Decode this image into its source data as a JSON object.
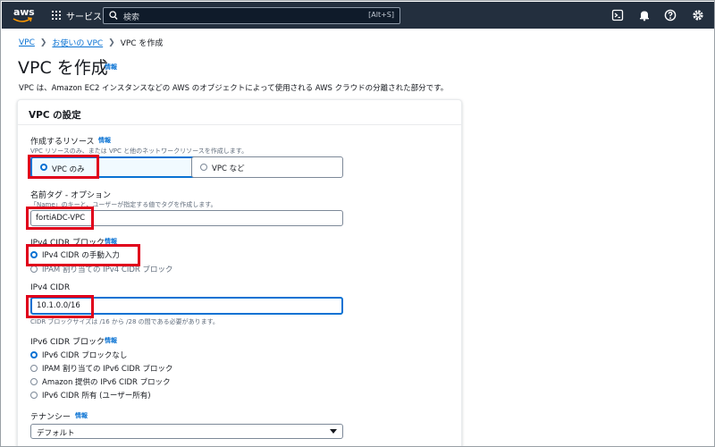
{
  "nav": {
    "logo_text": "aws",
    "services_label": "サービス",
    "search_placeholder": "検索",
    "search_shortcut": "[Alt+S]"
  },
  "breadcrumb": {
    "items": [
      "VPC",
      "お使いの VPC",
      "VPC を作成"
    ]
  },
  "page": {
    "title": "VPC を作成",
    "info": "情報",
    "description": "VPC は、Amazon EC2 インスタンスなどの AWS のオブジェクトによって使用される AWS クラウドの分離された部分です。"
  },
  "vpc_settings": {
    "title": "VPC の設定",
    "resources": {
      "label": "作成するリソース",
      "info": "情報",
      "hint": "VPC リソースのみ、または VPC と他のネットワークリソースを作成します。",
      "options": [
        "VPC のみ",
        "VPC など"
      ],
      "selected": "VPC のみ"
    },
    "name_tag": {
      "label": "名前タグ - オプション",
      "hint": "「Name」のキーと、ユーザーが指定する値でタグを作成します。",
      "value": "fortiADC-VPC"
    },
    "ipv4_block": {
      "label": "IPv4 CIDR ブロック",
      "info": "情報",
      "options": [
        "IPv4 CIDR の手動入力",
        "IPAM 割り当ての IPv4 CIDR ブロック"
      ],
      "selected": "IPv4 CIDR の手動入力"
    },
    "ipv4_cidr": {
      "label": "IPv4 CIDR",
      "value": "10.1.0.0/16",
      "hint": "CIDR ブロックサイズは /16 から /28 の間である必要があります。"
    },
    "ipv6_block": {
      "label": "IPv6 CIDR ブロック",
      "info": "情報",
      "options": [
        "IPv6 CIDR ブロックなし",
        "IPAM 割り当ての IPv6 CIDR ブロック",
        "Amazon 提供の IPv6 CIDR ブロック",
        "IPv6 CIDR 所有 (ユーザー所有)"
      ],
      "selected": "IPv6 CIDR ブロックなし"
    },
    "tenancy": {
      "label": "テナンシー",
      "info": "情報",
      "value": "デフォルト"
    }
  },
  "colors": {
    "nav_bg": "#232f3e",
    "link": "#0972d3",
    "annotation": "#e0001b"
  }
}
